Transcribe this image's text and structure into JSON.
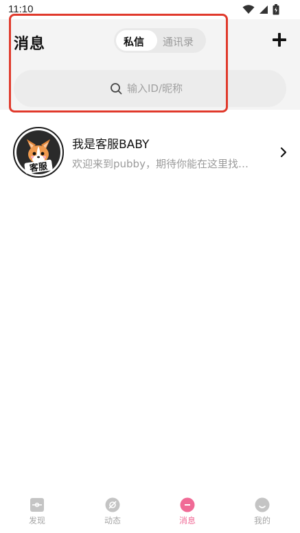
{
  "status_bar": {
    "time": "11:10",
    "icons": [
      "wifi-icon",
      "signal-icon",
      "battery-icon"
    ]
  },
  "header": {
    "title": "消息",
    "tabs": [
      {
        "label": "私信",
        "active": true
      },
      {
        "label": "通讯录",
        "active": false
      }
    ],
    "add_icon": "plus-icon"
  },
  "search": {
    "placeholder": "输入ID/昵称",
    "icon": "search-icon"
  },
  "conversations": [
    {
      "name": "我是客服BABY",
      "preview": "欢迎来到pubby，期待你能在这里找…",
      "avatar_badge": "客服",
      "avatar_icon": "corgi-avatar-icon"
    }
  ],
  "bottom_nav": [
    {
      "label": "发现",
      "icon": "discover-icon",
      "active": false
    },
    {
      "label": "动态",
      "icon": "moments-icon",
      "active": false
    },
    {
      "label": "消息",
      "icon": "message-icon",
      "active": true
    },
    {
      "label": "我的",
      "icon": "profile-icon",
      "active": false
    }
  ],
  "colors": {
    "accent": "#f06a96",
    "highlight_frame": "#e0392b",
    "header_bg": "#f4f4f4"
  }
}
